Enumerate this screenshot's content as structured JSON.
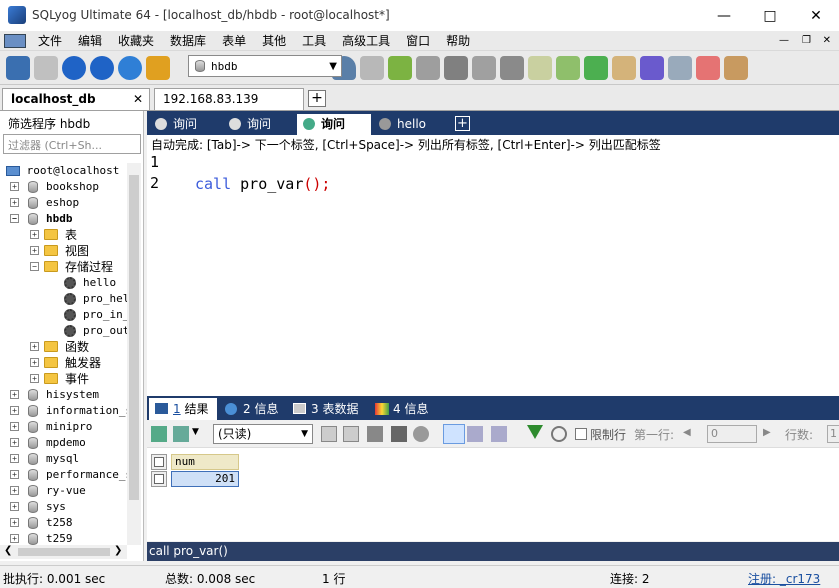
{
  "window": {
    "title": "SQLyog Ultimate 64 - [localhost_db/hbdb - root@localhost*]"
  },
  "menu": [
    "文件",
    "编辑",
    "收藏夹",
    "数据库",
    "表单",
    "其他",
    "工具",
    "高级工具",
    "窗口",
    "帮助"
  ],
  "toolbar": {
    "db_selected": "hbdb"
  },
  "connections": [
    {
      "label": "localhost_db",
      "active": true
    },
    {
      "label": "192.168.83.139",
      "active": false
    }
  ],
  "left": {
    "filter_label": "筛选程序 hbdb",
    "filter_placeholder": "过滤器 (Ctrl+Sh...",
    "root": "root@localhost",
    "databases": [
      "bookshop",
      "eshop",
      "hbdb",
      "hisystem",
      "information_s",
      "minipro",
      "mpdemo",
      "mysql",
      "performance_s",
      "ry-vue",
      "sys",
      "t258",
      "t259"
    ],
    "hbdb_children": [
      "表",
      "视图",
      "存储过程",
      "函数",
      "触发器",
      "事件"
    ],
    "procedures": [
      "hello",
      "pro_hel",
      "pro_in_",
      "pro_out"
    ]
  },
  "query_tabs": [
    {
      "label": "询问",
      "active": false
    },
    {
      "label": "询问",
      "active": false
    },
    {
      "label": "询问",
      "active": true
    },
    {
      "label": "hello",
      "active": false
    }
  ],
  "autocomplete": "自动完成:  [Tab]-> 下一个标签,  [Ctrl+Space]-> 列出所有标签,  [Ctrl+Enter]-> 列出匹配标签",
  "editor": {
    "lines": [
      "1",
      "2"
    ],
    "code_keyword": "call",
    "code_name": " pro_var",
    "code_paren": "();"
  },
  "result_tabs": [
    {
      "num": "1",
      "label": "结果"
    },
    {
      "num": "2",
      "label": "信息"
    },
    {
      "num": "3",
      "label": "表数据"
    },
    {
      "num": "4",
      "label": "信息"
    }
  ],
  "result_toolbar": {
    "mode": "(只读)",
    "limit_label": "限制行",
    "first_row_label": "第一行:",
    "first_row_value": "0",
    "rows_label": "行数:",
    "rows_value": "1"
  },
  "grid": {
    "column": "num",
    "value": "201"
  },
  "statusline": "call pro_var()",
  "status": {
    "exec": "批执行: 0.001 sec",
    "total": "总数: 0.008 sec",
    "rows": "1 行",
    "conn": "连接: 2",
    "register": "注册: _cr173"
  }
}
